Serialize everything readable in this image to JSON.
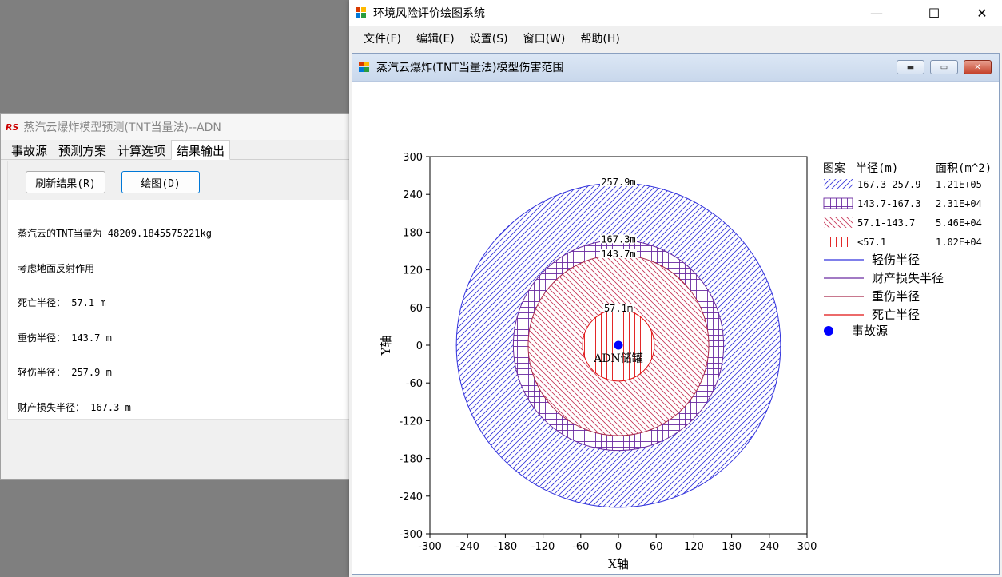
{
  "back_window": {
    "title": "蒸汽云爆炸模型预测(TNT当量法)--ADN",
    "logo_text": "RS",
    "tabs": [
      "事故源",
      "预测方案",
      "计算选项",
      "结果输出"
    ],
    "active_tab": "结果输出",
    "refresh_label": "刷新结果(R)",
    "draw_label": "绘图(D)",
    "result_lines": [
      "蒸汽云的TNT当量为 48209.1845575221kg",
      "考虑地面反射作用",
      "死亡半径： 57.1 m",
      "重伤半径： 143.7 m",
      "轻伤半径： 257.9 m",
      "财产损失半径： 167.3 m"
    ]
  },
  "front_window": {
    "title": "环境风险评价绘图系统",
    "controls": [
      "—",
      "☐",
      "✕"
    ],
    "menu": [
      "文件(F)",
      "编辑(E)",
      "设置(S)",
      "窗口(W)",
      "帮助(H)"
    ],
    "child_title": "蒸汽云爆炸(TNT当量法)模型伤害范围"
  },
  "chart_data": {
    "type": "concentric-circles",
    "xlabel": "X轴",
    "ylabel": "Y轴",
    "xlim": [
      -300,
      300
    ],
    "ylim": [
      -300,
      300
    ],
    "xticks": [
      -300,
      -240,
      -180,
      -120,
      -60,
      0,
      60,
      120,
      180,
      240,
      300
    ],
    "yticks": [
      300,
      240,
      180,
      120,
      60,
      0,
      -60,
      -120,
      -180,
      -240,
      -300
    ],
    "source": {
      "x": 0,
      "y": 0,
      "label": "ADN储罐",
      "color": "#0000ff"
    },
    "circles": [
      {
        "radius": 257.9,
        "label": "257.9m",
        "color": "#3333dd",
        "name": "轻伤半径"
      },
      {
        "radius": 167.3,
        "label": "167.3m",
        "color": "#6a2aa0",
        "name": "财产损失半径"
      },
      {
        "radius": 143.7,
        "label": "143.7m",
        "color": "#a8284a",
        "name": "重伤半径"
      },
      {
        "radius": 57.1,
        "label": "57.1m",
        "color": "#e01010",
        "name": "死亡半径"
      }
    ],
    "legend": {
      "headers": [
        "图案",
        "半径(m)",
        "面积(m^2)"
      ],
      "patterns": [
        {
          "range": "167.3-257.9",
          "area": "1.21E+05",
          "pattern": "diag-right",
          "color": "#3b3bdc"
        },
        {
          "range": "143.7-167.3",
          "area": "2.31E+04",
          "pattern": "grid",
          "color": "#6a2aa0"
        },
        {
          "range": "57.1-143.7",
          "area": "5.46E+04",
          "pattern": "diag-left",
          "color": "#c83a5a"
        },
        {
          "range": "<57.1",
          "area": "1.02E+04",
          "pattern": "vertical",
          "color": "#e01010"
        }
      ],
      "lines": [
        {
          "label": "轻伤半径",
          "color": "#3333dd"
        },
        {
          "label": "财产损失半径",
          "color": "#6a2aa0"
        },
        {
          "label": "重伤半径",
          "color": "#a8284a"
        },
        {
          "label": "死亡半径",
          "color": "#e01010"
        }
      ],
      "marker_label": "事故源"
    }
  }
}
